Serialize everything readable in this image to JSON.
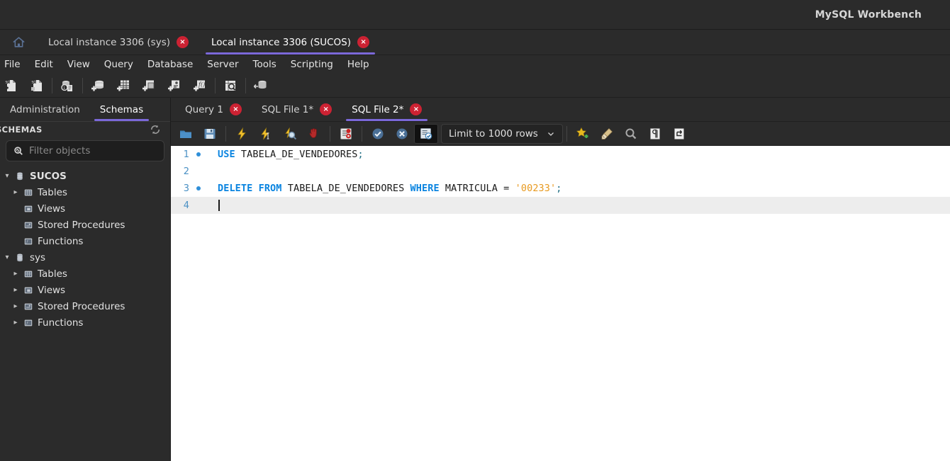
{
  "window": {
    "title": "MySQL Workbench"
  },
  "connection_tabs": {
    "home_icon": "home-icon",
    "items": [
      {
        "label": "Local instance 3306 (sys)",
        "active": false,
        "close_label": "×"
      },
      {
        "label": "Local instance 3306 (SUCOS)",
        "active": true,
        "close_label": "×"
      }
    ]
  },
  "menubar": {
    "items": [
      {
        "label": "File"
      },
      {
        "label": "Edit"
      },
      {
        "label": "View"
      },
      {
        "label": "Query"
      },
      {
        "label": "Database"
      },
      {
        "label": "Server"
      },
      {
        "label": "Tools"
      },
      {
        "label": "Scripting"
      },
      {
        "label": "Help"
      }
    ]
  },
  "main_toolbar": {
    "items": [
      {
        "icon": "new-sql-file-icon",
        "tooltip": "New SQL Tab"
      },
      {
        "icon": "open-sql-file-icon",
        "tooltip": "Open SQL Script"
      },
      {
        "icon": "connection-info-icon",
        "tooltip": "Connection Info"
      },
      {
        "icon": "new-schema-icon",
        "tooltip": "Create New Schema"
      },
      {
        "icon": "new-table-icon",
        "tooltip": "Create New Table"
      },
      {
        "icon": "new-view-icon",
        "tooltip": "Create New View"
      },
      {
        "icon": "new-procedure-icon",
        "tooltip": "Create New Procedure"
      },
      {
        "icon": "new-function-icon",
        "tooltip": "Create New Function"
      },
      {
        "icon": "search-table-icon",
        "tooltip": "Search Table Data"
      },
      {
        "icon": "reconnect-dbms-icon",
        "tooltip": "Reconnect to DBMS"
      }
    ]
  },
  "sidebar": {
    "tabs": [
      {
        "label": "Administration",
        "active": false
      },
      {
        "label": "Schemas",
        "active": true
      }
    ],
    "section_title": "SCHEMAS",
    "refresh_icon": "refresh-icon",
    "filter": {
      "placeholder": "Filter objects",
      "value": "",
      "icon": "search-icon"
    },
    "tree": [
      {
        "label": "SUCOS",
        "level": 0,
        "icon": "schema-icon",
        "expanded": true,
        "has_children": true,
        "bold": true
      },
      {
        "label": "Tables",
        "level": 1,
        "icon": "folder-table-icon",
        "expanded": false,
        "has_children": true,
        "bold": false
      },
      {
        "label": "Views",
        "level": 1,
        "icon": "folder-view-icon",
        "expanded": false,
        "has_children": false,
        "bold": false
      },
      {
        "label": "Stored Procedures",
        "level": 1,
        "icon": "folder-procedure-icon",
        "expanded": false,
        "has_children": false,
        "bold": false
      },
      {
        "label": "Functions",
        "level": 1,
        "icon": "folder-function-icon",
        "expanded": false,
        "has_children": false,
        "bold": false
      },
      {
        "label": "sys",
        "level": 0,
        "icon": "schema-icon",
        "expanded": true,
        "has_children": true,
        "bold": false
      },
      {
        "label": "Tables",
        "level": 1,
        "icon": "folder-table-icon",
        "expanded": false,
        "has_children": true,
        "bold": false
      },
      {
        "label": "Views",
        "level": 1,
        "icon": "folder-view-icon",
        "expanded": false,
        "has_children": true,
        "bold": false
      },
      {
        "label": "Stored Procedures",
        "level": 1,
        "icon": "folder-procedure-icon",
        "expanded": false,
        "has_children": true,
        "bold": false
      },
      {
        "label": "Functions",
        "level": 1,
        "icon": "folder-function-icon",
        "expanded": false,
        "has_children": true,
        "bold": false
      }
    ]
  },
  "editor": {
    "tabs": [
      {
        "label": "Query 1",
        "active": false,
        "close_label": "×"
      },
      {
        "label": "SQL File 1*",
        "active": false,
        "close_label": "×"
      },
      {
        "label": "SQL File 2*",
        "active": true,
        "close_label": "×"
      }
    ],
    "query_toolbar": {
      "left_items": [
        {
          "icon": "open-file-icon",
          "tooltip": "Open a script file"
        },
        {
          "icon": "save-file-icon",
          "tooltip": "Save script to file"
        },
        {
          "icon": "execute-all-icon",
          "tooltip": "Execute statement"
        },
        {
          "icon": "execute-current-icon",
          "tooltip": "Execute current statement"
        },
        {
          "icon": "explain-plan-icon",
          "tooltip": "Explain current statement"
        },
        {
          "icon": "stop-execution-icon",
          "tooltip": "Stop statement"
        },
        {
          "icon": "toggle-stop-on-error-icon",
          "tooltip": "Toggle stop on error"
        },
        {
          "icon": "commit-icon",
          "tooltip": "Commit transaction"
        },
        {
          "icon": "rollback-icon",
          "tooltip": "Rollback transaction"
        },
        {
          "icon": "autocommit-icon",
          "tooltip": "Toggle auto-commit",
          "pressed": true
        }
      ],
      "limit_dropdown": {
        "label": "Limit to 1000 rows",
        "chevron": "chevron-down-icon"
      },
      "right_items": [
        {
          "icon": "save-snippet-icon",
          "tooltip": "Save snippet"
        },
        {
          "icon": "beautify-sql-icon",
          "tooltip": "Beautify SQL"
        },
        {
          "icon": "find-icon",
          "tooltip": "Find"
        },
        {
          "icon": "invisible-chars-icon",
          "tooltip": "Toggle invisible characters"
        },
        {
          "icon": "wrap-lines-icon",
          "tooltip": "Toggle wrapping"
        }
      ]
    },
    "code": {
      "lines": [
        {
          "number": "1",
          "marker": true,
          "current": false,
          "tokens": [
            {
              "t": "USE",
              "k": "kw"
            },
            {
              "t": " TABELA_DE_VENDEDORES",
              "k": "id"
            },
            {
              "t": ";",
              "k": "punc"
            }
          ]
        },
        {
          "number": "2",
          "marker": false,
          "current": false,
          "tokens": []
        },
        {
          "number": "3",
          "marker": true,
          "current": false,
          "tokens": [
            {
              "t": "DELETE FROM",
              "k": "kw"
            },
            {
              "t": " TABELA_DE_VENDEDORES ",
              "k": "id"
            },
            {
              "t": "WHERE",
              "k": "kw"
            },
            {
              "t": " MATRICULA = ",
              "k": "id"
            },
            {
              "t": "'00233'",
              "k": "str"
            },
            {
              "t": ";",
              "k": "punc"
            }
          ]
        },
        {
          "number": "4",
          "marker": false,
          "current": true,
          "tokens": [],
          "caret": true
        }
      ]
    }
  },
  "colors": {
    "accent_purple": "#7b68d9",
    "close_red": "#cc2233",
    "keyword_blue": "#0a84e0",
    "string_orange": "#e89a20",
    "chrome_dark": "#2b2b2b",
    "editor_white": "#ffffff",
    "current_line": "#ededed"
  }
}
